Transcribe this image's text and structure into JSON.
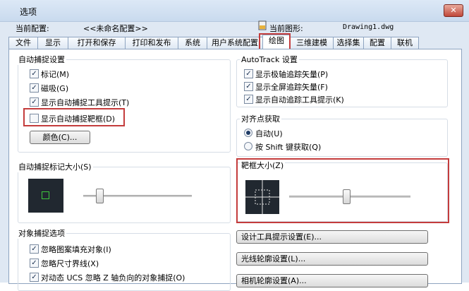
{
  "window": {
    "title": "选项",
    "close_glyph": "✕"
  },
  "profile": {
    "label": "当前配置:",
    "value": "<<未命名配置>>"
  },
  "drawing": {
    "label": "当前图形:",
    "value": "Drawing1.dwg"
  },
  "tabs": [
    "文件",
    "显示",
    "打开和保存",
    "打印和发布",
    "系统",
    "用户系统配置",
    "绘图",
    "三维建模",
    "选择集",
    "配置",
    "联机"
  ],
  "active_tab": "绘图",
  "autosnap": {
    "title": "自动捕捉设置",
    "options": [
      {
        "label": "标记(M)",
        "checked": true
      },
      {
        "label": "磁吸(G)",
        "checked": true
      },
      {
        "label": "显示自动捕捉工具提示(T)",
        "checked": true
      },
      {
        "label": "显示自动捕捉靶框(D)",
        "checked": false
      }
    ],
    "color_button": "颜色(C)..."
  },
  "autotrack": {
    "title": "AutoTrack 设置",
    "options": [
      {
        "label": "显示极轴追踪矢量(P)",
        "checked": true
      },
      {
        "label": "显示全屏追踪矢量(F)",
        "checked": true
      },
      {
        "label": "显示自动追踪工具提示(K)",
        "checked": true
      }
    ]
  },
  "alignment": {
    "title": "对齐点获取",
    "options": [
      {
        "label": "自动(U)",
        "selected": true
      },
      {
        "label": "按 Shift 键获取(Q)",
        "selected": false
      }
    ]
  },
  "marker_size": {
    "title": "自动捕捉标记大小(S)",
    "level": 0.08
  },
  "aperture_size": {
    "title": "靶框大小(Z)",
    "level": 0.47
  },
  "object_snap": {
    "title": "对象捕捉选项",
    "options": [
      {
        "label": "忽略图案填充对象(I)",
        "checked": true
      },
      {
        "label": "忽略尺寸界线(X)",
        "checked": true
      },
      {
        "label": "对动态 UCS 忽略 Z 轴负向的对象捕捉(O)",
        "checked": true
      }
    ]
  },
  "buttons": {
    "design_tooltip": "设计工具提示设置(E)...",
    "light_glyph": "光线轮廓设置(L)...",
    "camera_glyph": "相机轮廓设置(A)..."
  },
  "colors": {
    "accent_red": "#c43c3c",
    "snap_green": "#3ec83e",
    "preview_bg": "#212830"
  }
}
